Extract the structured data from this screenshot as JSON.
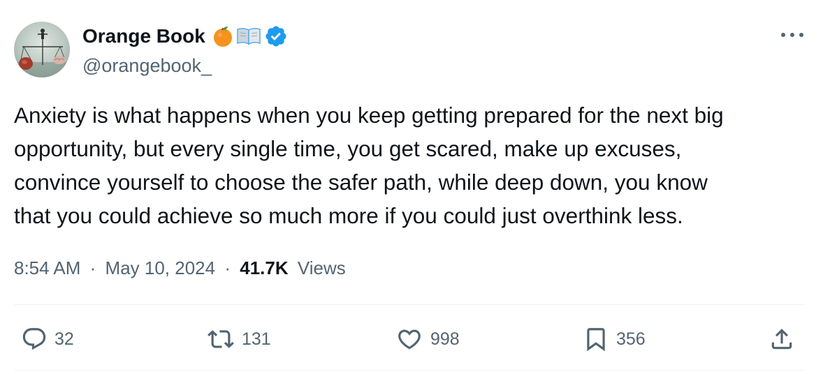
{
  "author": {
    "display_name": "Orange Book",
    "handle": "@orangebook_",
    "verified": true,
    "name_emojis": [
      "orange-emoji",
      "open-book-emoji"
    ]
  },
  "tweet": {
    "text": "Anxiety is what happens when you keep getting prepared for the next big\nopportunity, but every single time, you get scared, make up excuses,\nconvince yourself to choose the safer path, while deep down, you know\nthat you could achieve so much more if you could just overthink less.",
    "time": "8:54 AM",
    "separator": "·",
    "date": "May 10, 2024",
    "views_count": "41.7K",
    "views_label": "Views"
  },
  "actions": {
    "replies": "32",
    "reposts": "131",
    "likes": "998",
    "bookmarks": "356"
  },
  "icons": {
    "more": "more-horizontal-icon",
    "reply": "reply-icon",
    "repost": "repost-icon",
    "like": "heart-icon",
    "bookmark": "bookmark-icon",
    "share": "share-icon",
    "verified": "verified-badge-icon"
  },
  "colors": {
    "text_primary": "#0f1419",
    "text_secondary": "#536471",
    "verified_blue": "#1d9bf0",
    "divider": "#eff3f4",
    "orange": "#f6921e"
  }
}
